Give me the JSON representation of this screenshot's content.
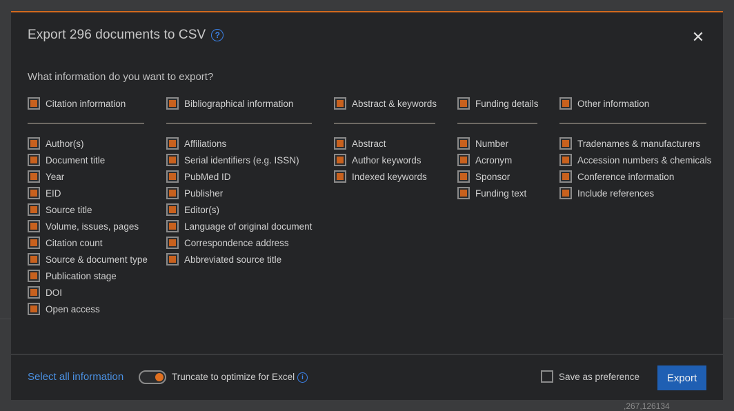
{
  "dialog": {
    "title": "Export 296 documents to CSV",
    "help_icon": "question-circle-icon",
    "close_icon": "close-icon",
    "question": "What information do you want to export?"
  },
  "columns": [
    {
      "heading": "Citation information",
      "items": [
        "Author(s)",
        "Document title",
        "Year",
        "EID",
        "Source title",
        "Volume, issues, pages",
        "Citation count",
        "Source & document type",
        "Publication stage",
        "DOI",
        "Open access"
      ]
    },
    {
      "heading": "Bibliographical information",
      "items": [
        "Affiliations",
        "Serial identifiers (e.g. ISSN)",
        "PubMed ID",
        "Publisher",
        "Editor(s)",
        "Language of original document",
        "Correspondence address",
        "Abbreviated source title"
      ]
    },
    {
      "heading": "Abstract & keywords",
      "items": [
        "Abstract",
        "Author keywords",
        "Indexed keywords"
      ]
    },
    {
      "heading": "Funding details",
      "items": [
        "Number",
        "Acronym",
        "Sponsor",
        "Funding text"
      ]
    },
    {
      "heading": "Other information",
      "items": [
        "Tradenames & manufacturers",
        "Accession numbers & chemicals",
        "Conference information",
        "Include references"
      ]
    }
  ],
  "footer": {
    "select_all": "Select all information",
    "truncate_label": "Truncate to optimize for Excel",
    "truncate_on": true,
    "info_icon": "info-circle-icon",
    "save_preference": "Save as preference",
    "save_preference_checked": false,
    "export_button": "Export"
  },
  "background": {
    "fragment": ",267,126134"
  },
  "colors": {
    "accent_orange": "#c8611e",
    "link_blue": "#4a90e2",
    "button_blue": "#1f5fb3",
    "dialog_bg": "#242527"
  }
}
